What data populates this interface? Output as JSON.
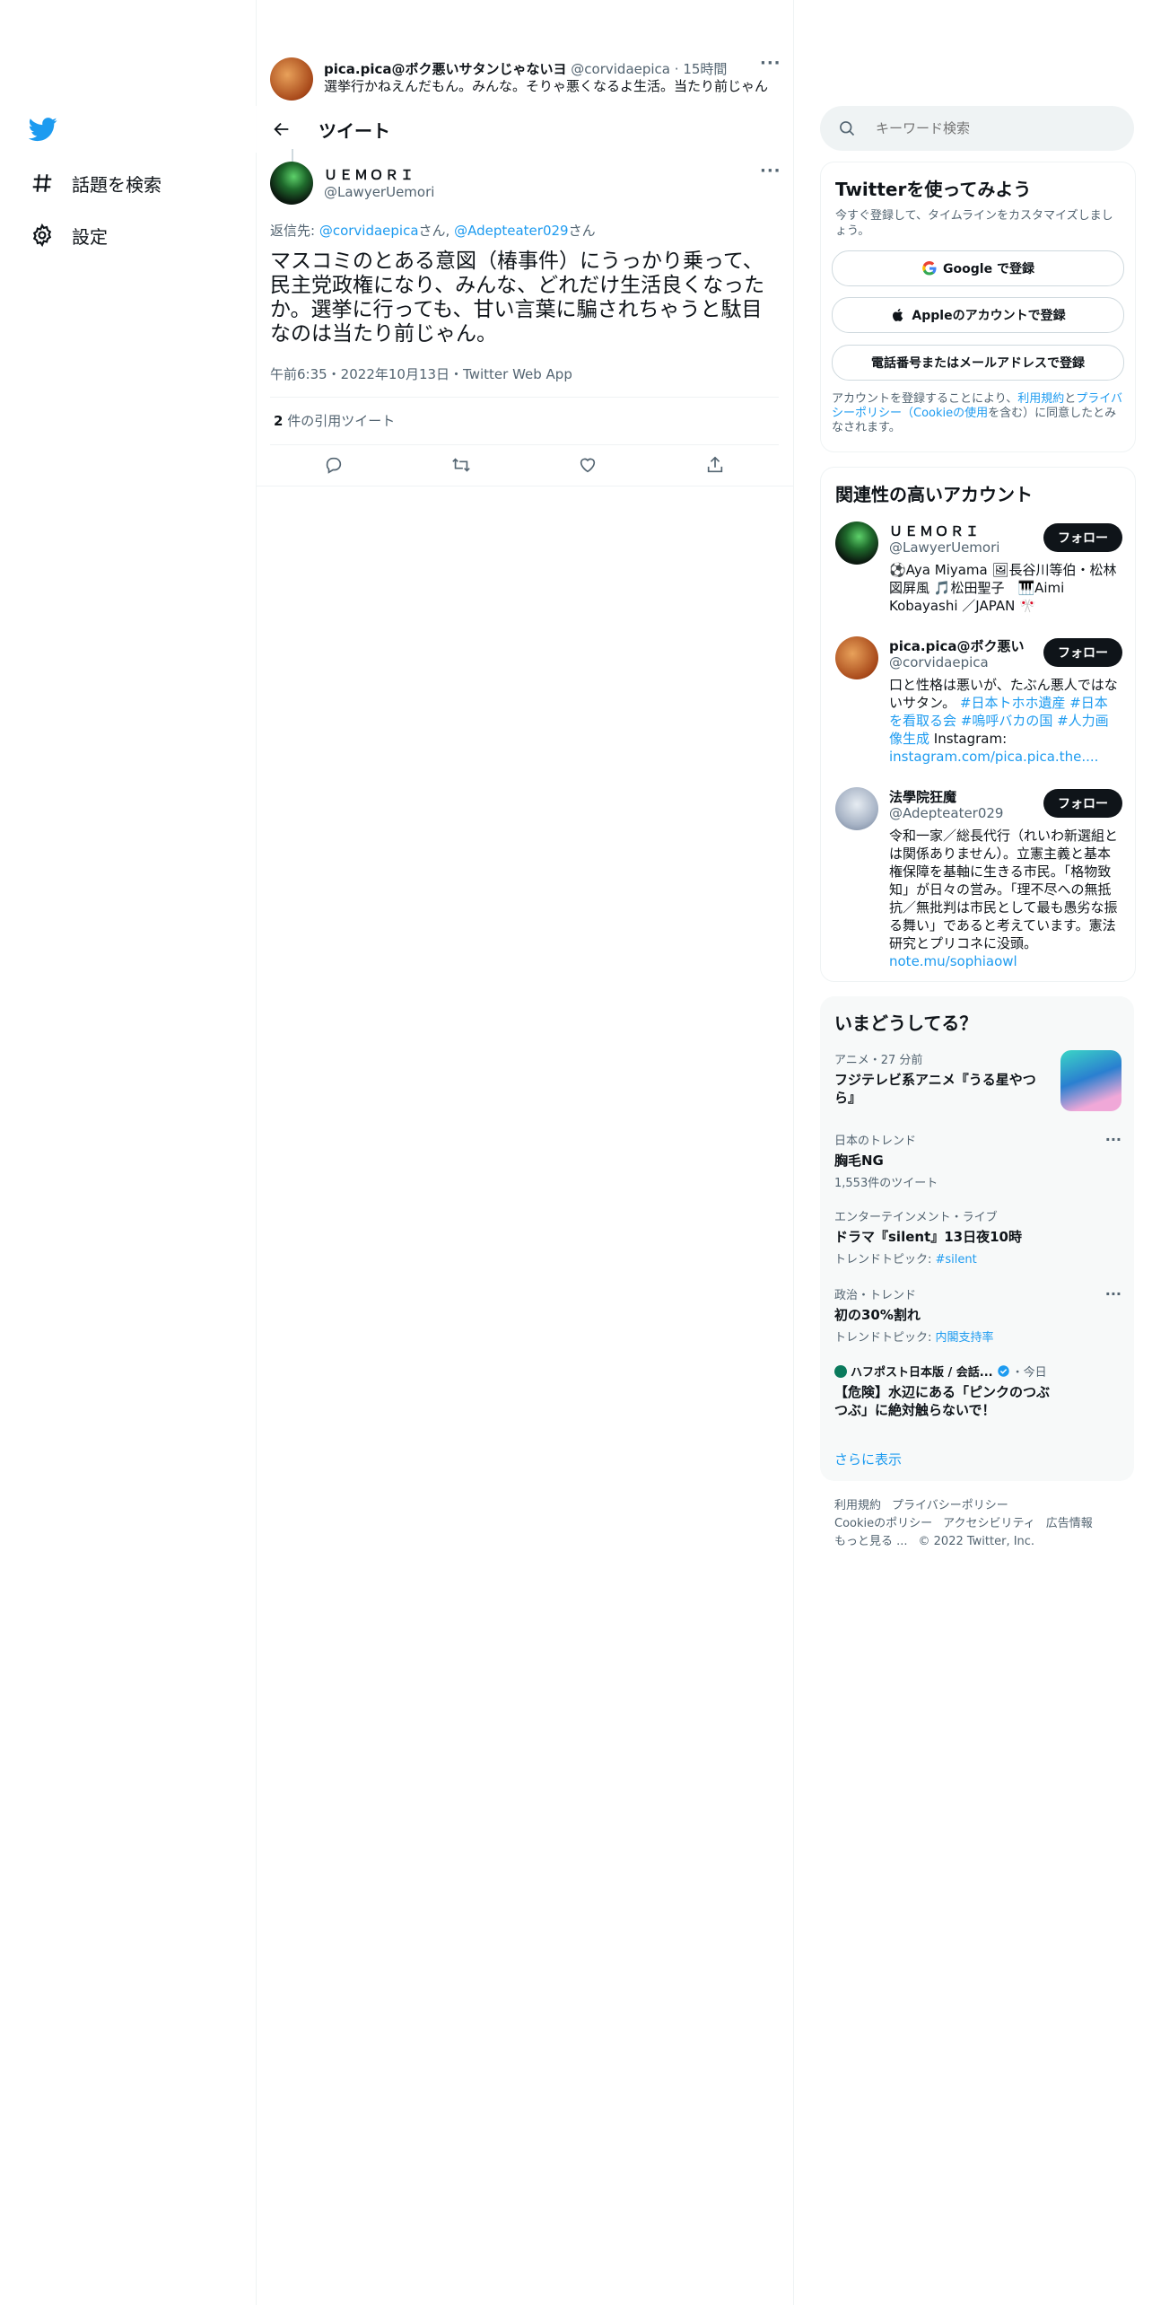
{
  "nav": {
    "explore": "話題を検索",
    "settings": "設定"
  },
  "prev_tweet": {
    "name": "pica.pica@ボク悪いサタンじゃないヨ",
    "handle": "@corvidaepica",
    "time": "15時間",
    "text": "選挙行かねえんだもん。みんな。そりゃ悪くなるよ生活。当たり前じゃん"
  },
  "header": {
    "title": "ツイート"
  },
  "tweet": {
    "author_name": "ＵＥＭＯＲＩ",
    "author_handle": "@LawyerUemori",
    "reply_prefix": "返信先: ",
    "reply_user1": "@corvidaepica",
    "reply_mid": "さん, ",
    "reply_user2": "@Adepteater029",
    "reply_suffix": "さん",
    "text": "マスコミのとある意図（椿事件）にうっかり乗って、民主党政権になり、みんな、どれだけ生活良くなったか。選挙に行っても、甘い言葉に騙されちゃうと駄目なのは当たり前じゃん。",
    "meta": "午前6:35・2022年10月13日・Twitter Web App",
    "quote_count": "2",
    "quote_label": "件の引用ツイート"
  },
  "search": {
    "placeholder": "キーワード検索"
  },
  "signup": {
    "title": "Twitterを使ってみよう",
    "subtitle": "今すぐ登録して、タイムラインをカスタマイズしましょう。",
    "google": "Google で登録",
    "apple": "Appleのアカウントで登録",
    "phone": "電話番号またはメールアドレスで登録",
    "terms_1": "アカウントを登録することにより、",
    "terms_link1": "利用規約",
    "terms_2": "と",
    "terms_link2": "プライバシーポリシー（Cookieの使用",
    "terms_3": "を含む）に同意したとみなされます。"
  },
  "related": {
    "title": "関連性の高いアカウント",
    "follow_label": "フォロー",
    "accounts": [
      {
        "name": "ＵＥＭＯＲＩ",
        "handle": "@LawyerUemori",
        "bio": "⚽Aya Miyama 🖼長谷川等伯・松林図屏風 🎵松田聖子　🎹Aimi Kobayashi ／JAPAN 🎌"
      },
      {
        "name": "pica.pica@ボク悪いサ...",
        "handle": "@corvidaepica",
        "bio_text": "口と性格は悪いが、たぶん悪人ではないサタン。 ",
        "bio_tags": "#日本トホホ遺産 #日本を看取る会 #嗚呼バカの国 #人力画像生成",
        "bio_ig": " Instagram: ",
        "bio_link": "instagram.com/pica.pica.the...."
      },
      {
        "name": "法學院狂魔",
        "handle": "@Adepteater029",
        "bio_text": "令和一家／総長代行（れいわ新選組とは関係ありません）。立憲主義と基本権保障を基軸に生きる市民。「格物致知」が日々の営み。「理不尽への無抵抗／無批判は市民として最も愚劣な振る舞い」であると考えています。憲法研究とプリコネに没頭。",
        "bio_link": "note.mu/sophiaowl"
      }
    ]
  },
  "trends": {
    "title": "いまどうしてる？",
    "items": [
      {
        "category": "アニメ・27 分前",
        "title": "フジテレビ系アニメ『うる星やつら』"
      },
      {
        "category": "日本のトレンド",
        "title": "胸毛NG",
        "sub": "1,553件のツイート"
      },
      {
        "category": "エンターテインメント・ライブ",
        "title": "ドラマ『silent』13日夜10時",
        "sub_prefix": "トレンドトピック: ",
        "sub_link": "#silent"
      },
      {
        "category": "政治・トレンド",
        "title": "初の30%割れ",
        "sub_prefix": "トレンドトピック: ",
        "sub_link": "内閣支持率"
      },
      {
        "category_source": "ハフポスト日本版 / 会話...",
        "category_time": "・今日",
        "title": "【危険】水辺にある「ピンクのつぶつぶ」に絶対触らないで！"
      }
    ],
    "show_more": "さらに表示"
  },
  "footer": {
    "terms": "利用規約",
    "privacy": "プライバシーポリシー",
    "cookie": "Cookieのポリシー",
    "accessibility": "アクセシビリティ",
    "ads": "広告情報",
    "more": "もっと見る ...",
    "copyright": "© 2022 Twitter, Inc."
  },
  "colors": {
    "accent": "#1d9bf0",
    "text": "#0f1419",
    "muted": "#536471",
    "border": "#eff3f4"
  }
}
